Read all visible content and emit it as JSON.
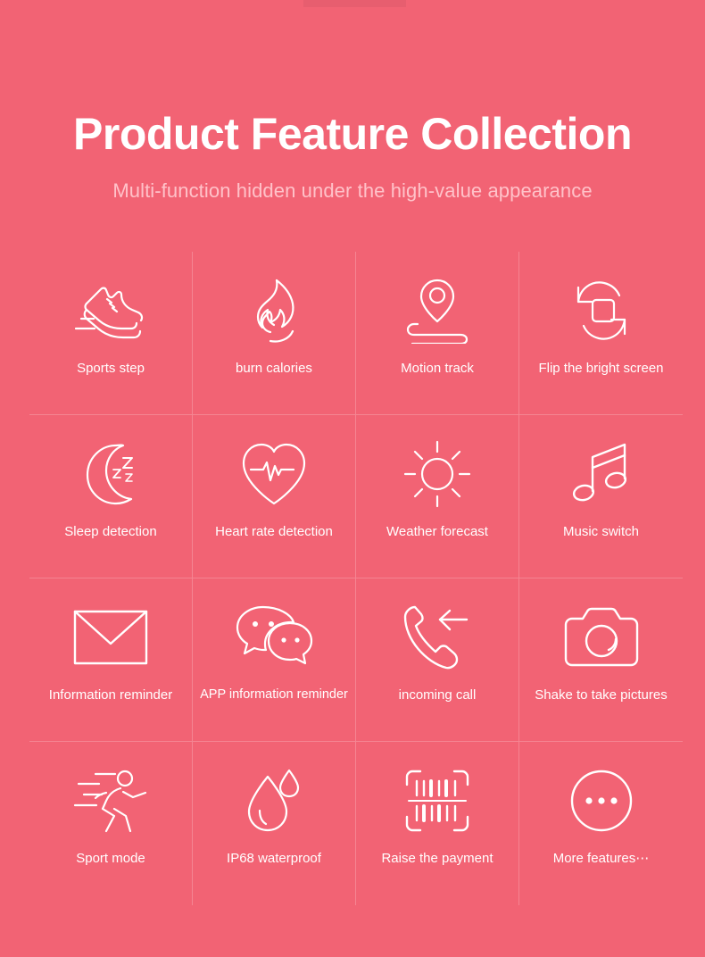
{
  "header": {
    "title": "Product Feature Collection",
    "subtitle": "Multi-function hidden under the high-value appearance"
  },
  "colors": {
    "background": "#f26374",
    "title_text": "#ffffff",
    "subtitle_text": "#ffc2c9",
    "label_text": "#ffffff",
    "grid_line": "rgba(255,255,255,0.22)",
    "icon_stroke": "#ffffff"
  },
  "grid": {
    "columns": 4,
    "rows": 4,
    "features": [
      {
        "icon": "running-shoe-icon",
        "label": "Sports step"
      },
      {
        "icon": "flame-icon",
        "label": "burn calories"
      },
      {
        "icon": "map-pin-track-icon",
        "label": "Motion track"
      },
      {
        "icon": "rotate-screen-icon",
        "label": "Flip the bright screen"
      },
      {
        "icon": "crescent-moon-sleep-icon",
        "label": "Sleep detection"
      },
      {
        "icon": "heart-pulse-icon",
        "label": "Heart rate detection"
      },
      {
        "icon": "sun-icon",
        "label": "Weather forecast"
      },
      {
        "icon": "music-note-icon",
        "label": "Music switch"
      },
      {
        "icon": "envelope-icon",
        "label": "Information reminder"
      },
      {
        "icon": "chat-bubbles-icon",
        "label": "APP information reminder"
      },
      {
        "icon": "incoming-call-icon",
        "label": "incoming call"
      },
      {
        "icon": "camera-icon",
        "label": "Shake to take pictures"
      },
      {
        "icon": "running-person-icon",
        "label": "Sport mode"
      },
      {
        "icon": "water-drop-icon",
        "label": "IP68 waterproof"
      },
      {
        "icon": "barcode-scan-icon",
        "label": "Raise the payment"
      },
      {
        "icon": "more-dots-icon",
        "label": "More features⋯"
      }
    ]
  }
}
